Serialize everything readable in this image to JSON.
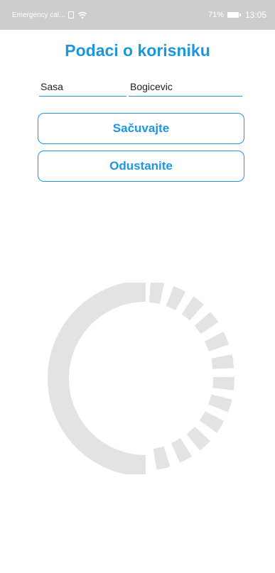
{
  "status_bar": {
    "carrier": "Emergency cal...",
    "battery": "71%",
    "time": "13:05"
  },
  "header": {
    "title": "Podaci o korisniku"
  },
  "form": {
    "first_name": "Sasa",
    "last_name": "Bogicevic"
  },
  "actions": {
    "save_label": "Sačuvajte",
    "cancel_label": "Odustanite"
  },
  "icons": {
    "sim": "sim-card-icon",
    "wifi": "wifi-icon",
    "battery": "battery-icon",
    "spinner": "loading-spinner-icon"
  },
  "colors": {
    "accent": "#1e96de",
    "status_bar": "#cdcdcd",
    "spinner": "#e3e3e3"
  }
}
